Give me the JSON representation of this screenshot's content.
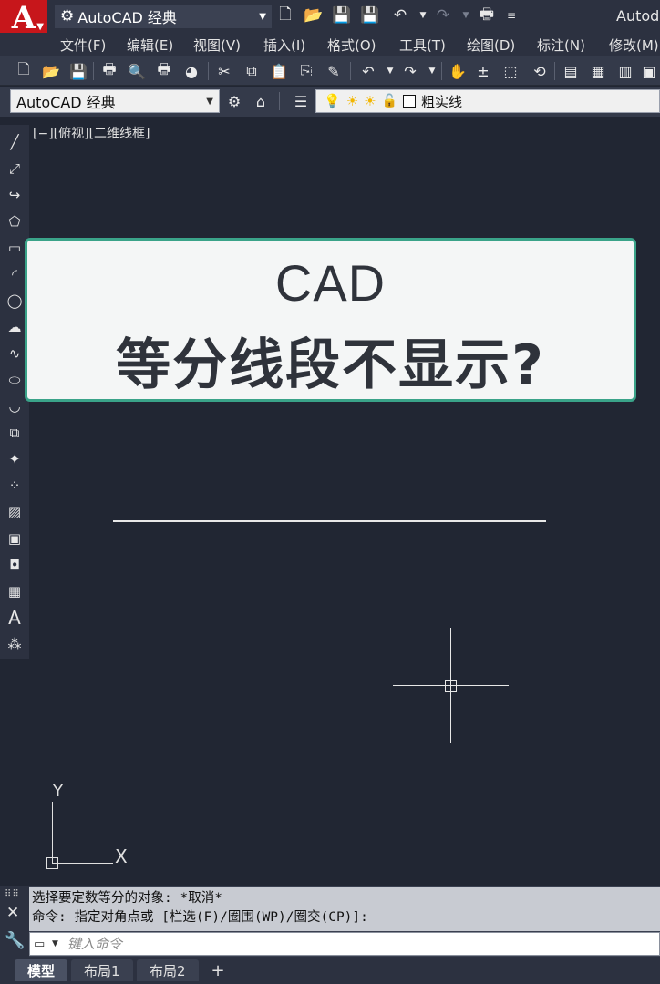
{
  "titlebar": {
    "app_logo_letter": "A",
    "workspace_quick": "AutoCAD 经典",
    "title": "Autod"
  },
  "menu": [
    "文件(F)",
    "编辑(E)",
    "视图(V)",
    "插入(I)",
    "格式(O)",
    "工具(T)",
    "绘图(D)",
    "标注(N)",
    "修改(M)"
  ],
  "layerbar": {
    "workspace": "AutoCAD 经典",
    "current_layer": "粗实线"
  },
  "viewport": {
    "label": "[−][俯视][二维线框]"
  },
  "overlay": {
    "line1": "CAD",
    "line2": "等分线段不显示?"
  },
  "ucs": {
    "y_label": "Y",
    "x_label": "X"
  },
  "command": {
    "history_line1": "选择要定数等分的对象: *取消*",
    "history_line2": "命令: 指定对角点或 [栏选(F)/圈围(WP)/圈交(CP)]:",
    "input_placeholder": "键入命令"
  },
  "layout_tabs": {
    "model": "模型",
    "layout1": "布局1",
    "layout2": "布局2",
    "add": "+"
  },
  "colors": {
    "accent_red": "#c7161b",
    "card_border": "#3aa389",
    "canvas_bg": "#212633"
  }
}
